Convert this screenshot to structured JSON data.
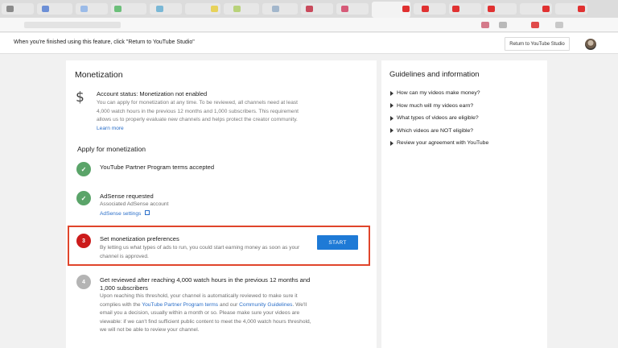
{
  "notice": {
    "text": "When you're finished using this feature, click \"Return to YouTube Studio\"",
    "return_button": "Return to YouTube Studio"
  },
  "monetization": {
    "title": "Monetization",
    "account_status": "Account status: Monetization not enabled",
    "account_desc_before_link": "You can apply for monetization at any time. To be reviewed, all channels need at least 4,000 watch hours in the previous 12 months and 1,000 subscribers. This requirement allows us to properly evaluate new channels and helps protect the creator community. ",
    "learn_more": "Learn more",
    "apply_heading": "Apply for monetization",
    "steps": [
      {
        "badge": "✓",
        "title": "YouTube Partner Program terms accepted",
        "status": "done"
      },
      {
        "badge": "✓",
        "title": "AdSense requested",
        "line1": "Associated AdSense account",
        "link": "AdSense settings",
        "status": "done"
      },
      {
        "badge": "3",
        "title": "Set monetization preferences",
        "desc": "By letting us what types of ads to run, you could start earning money as soon as your channel is approved.",
        "button": "START",
        "status": "current"
      },
      {
        "badge": "4",
        "title": "Get reviewed after reaching 4,000 watch hours in the previous 12 months and 1,000 subscribers",
        "desc_before_link1": "Upon reaching this threshold, your channel is automatically reviewed to make sure it complies with the ",
        "link1": "YouTube Partner Program terms",
        "desc_mid": " and our ",
        "link2": "Community Guidelines",
        "desc_after": ". We'll email you a decision, usually within a month or so. Please make sure your videos are viewable: if we can't find sufficient public content to meet the 4,000 watch hours threshold, we will not be able to review your channel.",
        "status": "pending"
      }
    ]
  },
  "guidelines": {
    "title": "Guidelines and information",
    "items": [
      "How can my videos make money?",
      "How much will my videos earn?",
      "What types of videos are eligible?",
      "Which videos are NOT eligible?",
      "Review your agreement with YouTube"
    ]
  },
  "colors": {
    "accent_blue": "#1e7ad6",
    "link_blue": "#2b6fc9",
    "done_green": "#5aa469",
    "current_red": "#cc1b1b",
    "highlight_border": "#e0452b"
  }
}
